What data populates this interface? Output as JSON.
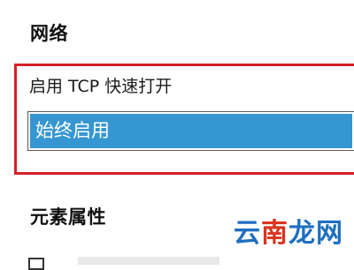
{
  "network_section": {
    "title": "网络",
    "tcp_fast_open": {
      "label": "启用 TCP 快速打开",
      "selected_value": "始终启用"
    }
  },
  "element_properties_section": {
    "title": "元素属性"
  },
  "watermark": {
    "part1": "云",
    "part2": "南",
    "part3": "龙网"
  },
  "colors": {
    "highlight_border": "#d4202a",
    "selection_background": "#3596d1",
    "selection_text": "#ffffff"
  }
}
